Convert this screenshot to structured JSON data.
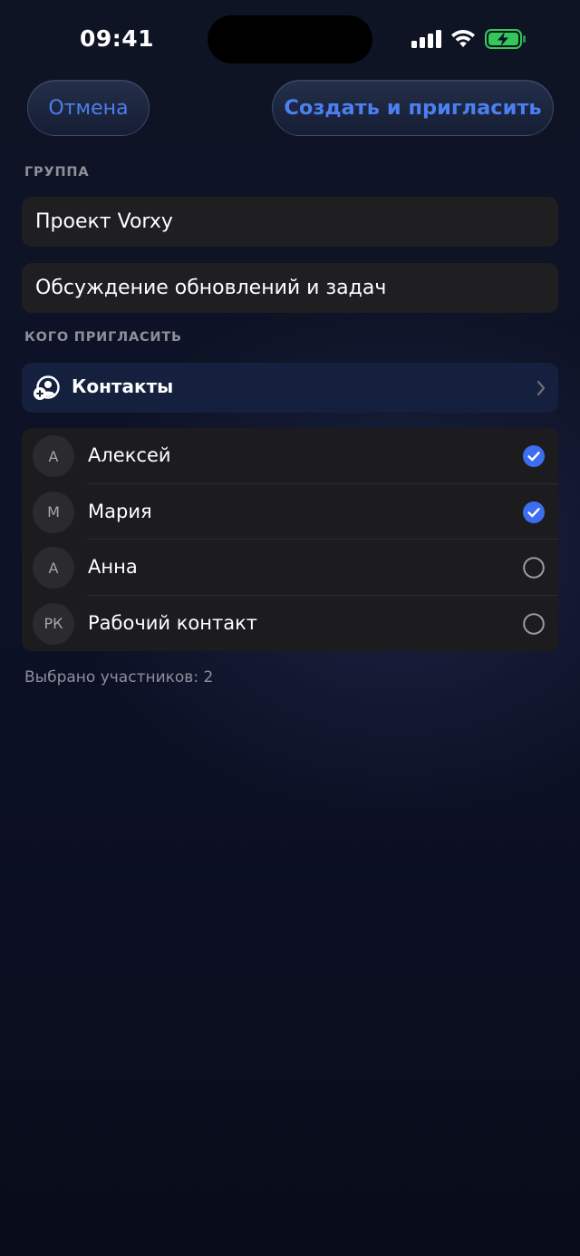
{
  "status_bar": {
    "time": "09:41"
  },
  "toolbar": {
    "cancel_label": "Отмена",
    "create_label": "Создать и пригласить"
  },
  "group_section": {
    "label": "ГРУППА",
    "name_value": "Проект Vorxy",
    "description_value": "Обсуждение обновлений и задач"
  },
  "invite_section": {
    "label": "КОГО ПРИГЛАСИТЬ",
    "contacts_label": "Контакты"
  },
  "contacts": [
    {
      "initials": "А",
      "name": "Алексей",
      "selected": true
    },
    {
      "initials": "М",
      "name": "Мария",
      "selected": true
    },
    {
      "initials": "А",
      "name": "Анна",
      "selected": false
    },
    {
      "initials": "РК",
      "name": "Рабочий контакт",
      "selected": false
    }
  ],
  "footer": {
    "selected_count_text": "Выбрано участников: 2"
  },
  "colors": {
    "accent": "#3d6ef0",
    "background": "#0d1226",
    "cell": "#1f1f22",
    "contacts_row": "#14203d",
    "secondary_text": "#8e8f99",
    "battery_green": "#34c759"
  }
}
